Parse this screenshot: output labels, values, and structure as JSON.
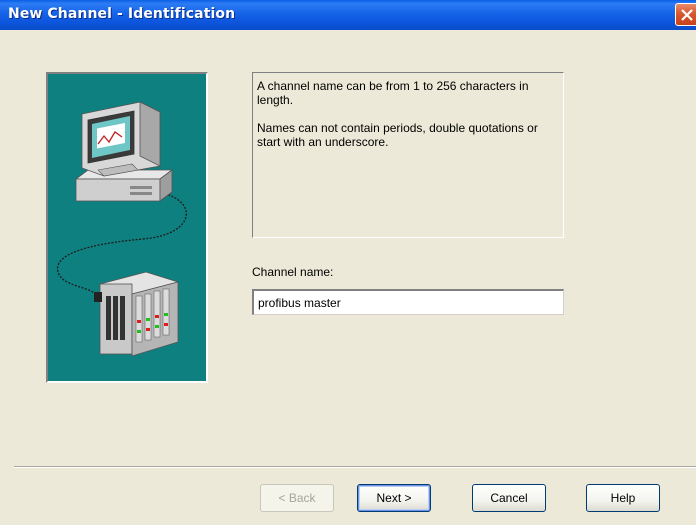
{
  "window": {
    "title": "New Channel - Identification"
  },
  "info": {
    "paragraph1": "A channel name can be from 1 to 256 characters in length.",
    "paragraph2": "Names can not contain periods, double quotations or start with an underscore."
  },
  "form": {
    "channel_label": "Channel name:",
    "channel_value": "profibus master"
  },
  "buttons": {
    "back": "< Back",
    "next": "Next >",
    "cancel": "Cancel",
    "help": "Help"
  },
  "icons": {
    "close": "close-icon",
    "illustration": "computer-to-device-network-illustration"
  },
  "colors": {
    "titlebar": "#0c55dc",
    "illustration_background": "#0f8080",
    "dialog_background": "#ece9d8"
  }
}
